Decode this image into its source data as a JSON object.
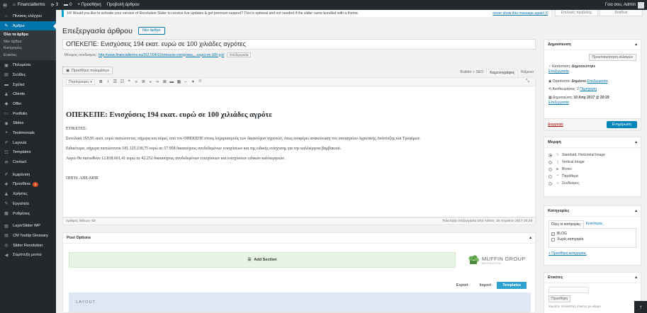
{
  "admin_bar": {
    "site_name": "Financialterms",
    "updates_count": "3",
    "comments_count": "0",
    "new_label": "Προσθήκη",
    "view_post": "Προβολή άρθρου",
    "greeting": "Γεια σου, Admin"
  },
  "sidebar": {
    "items": [
      {
        "icon": "dashboard-icon",
        "glyph": "⌂",
        "label": "Πίνακας ελέγχου"
      },
      {
        "icon": "pin-icon",
        "glyph": "✎",
        "label": "Άρθρα",
        "active": true
      },
      {
        "icon": "media-icon",
        "glyph": "▣",
        "label": "Πολυμέσα"
      },
      {
        "icon": "pages-icon",
        "glyph": "▤",
        "label": "Σελίδες"
      },
      {
        "icon": "comments-icon",
        "glyph": "▬",
        "label": "Σχόλια"
      },
      {
        "icon": "clients-icon",
        "glyph": "♟",
        "label": "Clients"
      },
      {
        "icon": "offer-icon",
        "glyph": "◆",
        "label": "Offer"
      },
      {
        "icon": "portfolio-icon",
        "glyph": "▭",
        "label": "Portfolio"
      },
      {
        "icon": "slides-icon",
        "glyph": "◉",
        "label": "Slides"
      },
      {
        "icon": "testimonials-icon",
        "glyph": "❝",
        "label": "Testimonials"
      },
      {
        "icon": "layouts-icon",
        "glyph": "✐",
        "label": "Layouts"
      },
      {
        "icon": "templates-icon",
        "glyph": "☷",
        "label": "Templates"
      },
      {
        "icon": "contact-icon",
        "glyph": "✉",
        "label": "Contact"
      },
      {
        "icon": "appearance-icon",
        "glyph": "✐",
        "label": "Εμφάνιση"
      },
      {
        "icon": "plugins-icon",
        "glyph": "✚",
        "label": "Πρόσθετα",
        "badge": "3"
      },
      {
        "icon": "users-icon",
        "glyph": "♟",
        "label": "Χρήστες"
      },
      {
        "icon": "tools-icon",
        "glyph": "✎",
        "label": "Εργαλεία"
      },
      {
        "icon": "settings-icon",
        "glyph": "▦",
        "label": "Ρυθμίσεις"
      },
      {
        "icon": "layerslider-icon",
        "glyph": "▧",
        "label": "LayerSlider WP"
      },
      {
        "icon": "tooltip-icon",
        "glyph": "▤",
        "label": "CM Tooltip Glossary"
      },
      {
        "icon": "revslider-icon",
        "glyph": "◎",
        "label": "Slider Revolution"
      },
      {
        "icon": "collapse-icon",
        "glyph": "◀",
        "label": "Σύμπτυξη μενού"
      }
    ],
    "submenu": [
      "Όλα τα άρθρα",
      "Νέο άρθρο",
      "Κατηγορίες",
      "Ετικέτες"
    ]
  },
  "notice": {
    "text": "Hi! Would you like to activate your version of Revolution Slider to receive live updates & get premium support? This is optional and not needed if the slider came bundled with a theme.",
    "dismiss": "never show this message again!  X"
  },
  "screen_options": {
    "left": "Επιλογές προβολής",
    "right": "Βοήθεια"
  },
  "page": {
    "title": "Επεξεργασία άρθρου",
    "add_new": "Νέο άρθρο",
    "post_title": "ΟΠΕΚΕΠΕ: Ενισχύσεις 194 εκατ. ευρώ σε 100 χιλιάδες αγρότες",
    "permalink_label": "Μόνιμος σύνδεσμος:",
    "permalink_url": "http://www.financialterms.eu/2017/04/10/οπεκεπε-ενισχύσεις...-ευρώ-σε-100-χιλ/",
    "permalink_edit": "Επεξεργασία",
    "add_media": "Προσθήκη πολυμέσων"
  },
  "editor": {
    "tabs": [
      "Builder » SEO",
      "Κειμενογράφος",
      "Κείμενο"
    ],
    "format_select": "Παράγραφος",
    "heading": "ΟΠΕΚΕΠΕ: Ενισχύσεις 194 εκατ. ευρώ σε 100 χιλιάδες αγρότε",
    "paragraphs": [
      "ΕΤΙΚΕΤΕΣ:",
      "Συνολικά 193,95 εκατ. ευρώ πιστώνονται, σήμερα και αύριο, από τον ΟΠΕΚΕΠΕ στους λογαριασμούς των δικαιούχων αγροτών, όπως αναφέρει ανακοίνωση του υπουργείου Αγροτικής Ανάπτυξης και Τροφίμων.",
      "Ειδικότερα, σήμερα πιστώνονται 181.125.230,75 ευρώ σε 57.958 δικαιούχους συνδεδεμένων ενισχύσεων και της ειδικής ενίσχυσης για την καλλιέργεια βαμβακιού.",
      "Αύριο θα πιστωθούν 12.818.601,41 ευρώ σε 42.252 δικαιούχους συνδεδεμένων ενισχύσεων και ενισχύσεων ειδικών καλλιεργειών."
    ],
    "source": "ΠΗΓΗ: ΑΠΕ-ΜΠΕ",
    "word_count": "Αριθμός λέξεων: 62",
    "last_edit": "Τελευταία επεξεργασία από Admin, 10 Απριλίου 2017 20:29"
  },
  "post_options": {
    "title": "Post Options",
    "add_section": "Add Section",
    "brand_title": "MUFFIN GROUP",
    "brand_sub": "MUFFIN-IN.COM",
    "export": "Export",
    "import": "Import",
    "templates": "Templates",
    "layout": "LAYOUT"
  },
  "publish": {
    "title": "Δημοσίευση",
    "preview": "Προεπισκόπηση αλλαγών",
    "status_label": "Κατάσταση:",
    "status_value": "Δημοσιεύτηκε",
    "visibility_label": "Ορατότητα:",
    "visibility_value": "Δημόσιο",
    "revisions": "Αναθεωρήσεις: 2",
    "revisions_link": "Περιήγηση",
    "published_label": "Δημοσιεύση:",
    "published_value": "10 Απρ 2017 @ 20:29",
    "edit": "Επεξεργασία",
    "trash": "Διαγραφή",
    "update": "Ενημέρωση"
  },
  "format": {
    "title": "Μορφή",
    "options": [
      {
        "label": "Standard, Horizontal Image",
        "icon": "pin-icon",
        "glyph": "✎",
        "checked": true
      },
      {
        "label": "Vertical Image",
        "icon": "image-icon",
        "glyph": "▯",
        "checked": false
      },
      {
        "label": "Βίντεο",
        "icon": "video-icon",
        "glyph": "▶",
        "checked": false
      },
      {
        "label": "Παράθεμα",
        "icon": "quote-icon",
        "glyph": "❝",
        "checked": false
      },
      {
        "label": "Σύνδεσμος",
        "icon": "link-icon",
        "glyph": "∞",
        "checked": false
      }
    ]
  },
  "categories": {
    "title": "Κατηγορίες",
    "tab_all": "Όλες οι κατηγορίες",
    "tab_popular": "Κοινότερες",
    "items": [
      {
        "label": "BLOG",
        "checked": true
      },
      {
        "label": "Χωρίς κατηγορία",
        "checked": false
      }
    ],
    "add_new": "+ Προσθήκη κατηγορίας"
  },
  "tags": {
    "title": "Ετικέτες",
    "add_button": "Προσθήκη",
    "help": "Χωρίστε πολλαπλές ετικέτες με κόμμα"
  }
}
